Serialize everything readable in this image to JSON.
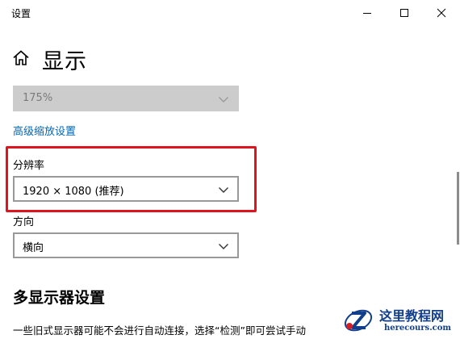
{
  "window": {
    "title": "设置",
    "controls": {
      "minimize_icon": "minimize-icon",
      "maximize_icon": "maximize-icon",
      "close_icon": "close-icon"
    }
  },
  "header": {
    "home_icon": "home-icon",
    "title": "显示"
  },
  "scale": {
    "value": "175%",
    "disabled": true
  },
  "advanced_scaling_link": "高级缩放设置",
  "resolution": {
    "label": "分辨率",
    "value": "1920 × 1080 (推荐)",
    "highlight_color": "#e0141e"
  },
  "orientation": {
    "label": "方向",
    "value": "横向"
  },
  "multi_display": {
    "heading": "多显示器设置",
    "description": "一些旧式显示器可能不会进行自动连接，选择“检测”即可尝试手动"
  },
  "watermark": {
    "name": "这里教程网",
    "url": "herecours.com"
  },
  "colors": {
    "link": "#0067b8",
    "disabled_bg": "#cccccc",
    "highlight": "#e0141e",
    "watermark": "#123e8c"
  }
}
